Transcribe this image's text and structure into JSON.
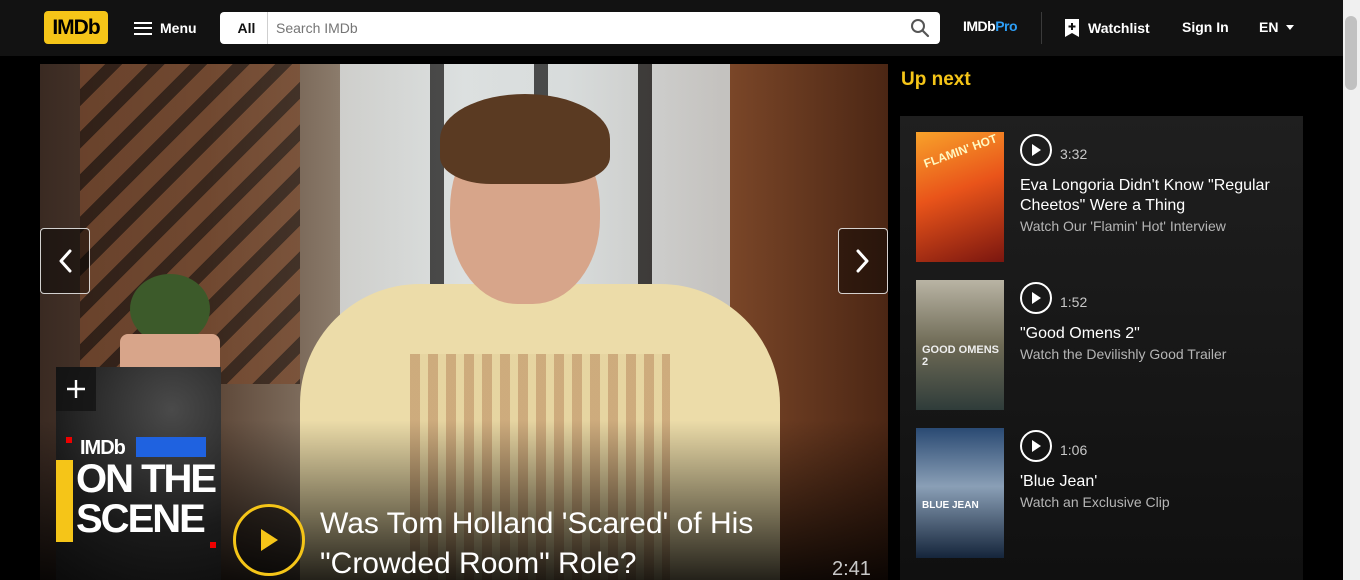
{
  "header": {
    "logo": "IMDb",
    "menu_label": "Menu",
    "search": {
      "category": "All",
      "placeholder": "Search IMDb"
    },
    "imdbpro_a": "IMDb",
    "imdbpro_b": "Pro",
    "watchlist_label": "Watchlist",
    "signin_label": "Sign In",
    "lang_label": "EN"
  },
  "hero": {
    "title": "Was Tom Holland 'Scared' of His \"Crowded Room\" Role?",
    "duration": "2:41",
    "poster": {
      "brand": "IMDb",
      "line1": "ON THE",
      "line2": "SCENE"
    }
  },
  "up_next": {
    "heading": "Up next",
    "items": [
      {
        "duration": "3:32",
        "title": "Eva Longoria Didn't Know \"Regular Cheetos\" Were a Thing",
        "subtitle": "Watch Our 'Flamin' Hot' Interview",
        "poster_text": "FLAMIN' HOT"
      },
      {
        "duration": "1:52",
        "title": "\"Good Omens 2\"",
        "subtitle": "Watch the Devilishly Good Trailer",
        "poster_text": "GOOD OMENS 2"
      },
      {
        "duration": "1:06",
        "title": "'Blue Jean'",
        "subtitle": "Watch an Exclusive Clip",
        "poster_text": "BLUE JEAN"
      }
    ]
  },
  "colors": {
    "brand_yellow": "#f5c518",
    "header_bg": "#121212",
    "pro_blue": "#2d9ef5"
  }
}
